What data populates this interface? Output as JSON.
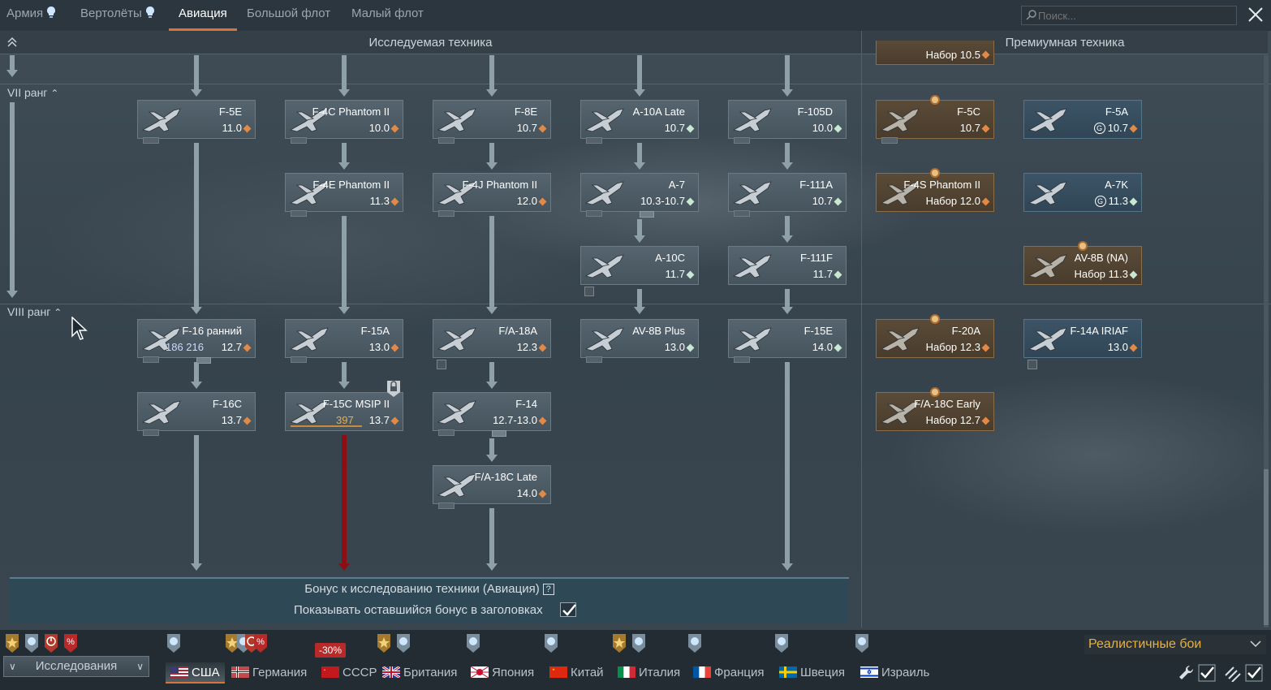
{
  "top_tabs": [
    {
      "label": "Армия",
      "bulb": true
    },
    {
      "label": "Вертолёты",
      "bulb": true
    },
    {
      "label": "Авиация",
      "active": true
    },
    {
      "label": "Большой флот"
    },
    {
      "label": "Малый флот"
    }
  ],
  "search": {
    "placeholder": "Поиск..."
  },
  "sections": {
    "researchable": "Исследуемая техника",
    "premium": "Премиумная техника"
  },
  "ranks": {
    "vii": "VII ранг",
    "viii": "VIII ранг"
  },
  "top_partial_card": {
    "br_text": "Набор 10.5"
  },
  "cards": [
    {
      "name": "F-5E",
      "br": "11.0",
      "type": "r"
    },
    {
      "name": "F-4C Phantom II",
      "br": "10.0",
      "type": "r"
    },
    {
      "name": "F-8E",
      "br": "10.7",
      "type": "r"
    },
    {
      "name": "A-10A Late",
      "br": "10.7",
      "type": "g"
    },
    {
      "name": "F-105D",
      "br": "10.0",
      "type": "g"
    },
    {
      "name": "F-5C",
      "br": "10.7",
      "type": "r"
    },
    {
      "name": "F-5A",
      "br": "10.7",
      "type": "r"
    },
    {
      "name": "F-4E Phantom II",
      "br": "11.3",
      "type": "r"
    },
    {
      "name": "F-4J Phantom II",
      "br": "12.0",
      "type": "r"
    },
    {
      "name": "A-7",
      "br": "10.3-10.7",
      "type": "g"
    },
    {
      "name": "F-111A",
      "br": "10.7",
      "type": "g"
    },
    {
      "name": "F-4S Phantom II",
      "br": "Набор 12.0",
      "type": "r"
    },
    {
      "name": "A-7K",
      "br": "11.3",
      "type": "g"
    },
    {
      "name": "A-10C",
      "br": "11.7",
      "type": "g"
    },
    {
      "name": "F-111F",
      "br": "11.7",
      "type": "g"
    },
    {
      "name": "AV-8B (NA)",
      "br": "Набор 11.3",
      "type": "g"
    },
    {
      "name": "F-16 ранний",
      "br": "12.7",
      "type": "r",
      "rp": "186 216"
    },
    {
      "name": "F-15A",
      "br": "13.0",
      "type": "r"
    },
    {
      "name": "F/A-18A",
      "br": "12.3",
      "type": "r"
    },
    {
      "name": "AV-8B Plus",
      "br": "13.0",
      "type": "g"
    },
    {
      "name": "F-15E",
      "br": "14.0",
      "type": "g"
    },
    {
      "name": "F-20A",
      "br": "Набор 12.3",
      "type": "r"
    },
    {
      "name": "F-14A IRIAF",
      "br": "13.0",
      "type": "r"
    },
    {
      "name": "F-16C",
      "br": "13.7",
      "type": "r"
    },
    {
      "name": "F-15C MSIP II",
      "br": "13.7",
      "type": "r",
      "rp": "397"
    },
    {
      "name": "F-14",
      "br": "12.7-13.0",
      "type": "r"
    },
    {
      "name": "F/A-18C Early",
      "br": "Набор 12.7",
      "type": "r"
    },
    {
      "name": "F/A-18C Late",
      "br": "14.0",
      "type": "r"
    }
  ],
  "bonus": {
    "title": "Бонус к исследованию техники (Авиация)",
    "help": "?",
    "show_label": "Показывать оставшийся бонус в заголовках",
    "checked": true
  },
  "bottom": {
    "research_label": "Исследования",
    "discount": "-30%",
    "nations": [
      {
        "label": "США",
        "active": true
      },
      {
        "label": "Германия"
      },
      {
        "label": "СССР"
      },
      {
        "label": "Британия"
      },
      {
        "label": "Япония"
      },
      {
        "label": "Китай"
      },
      {
        "label": "Италия"
      },
      {
        "label": "Франция"
      },
      {
        "label": "Швеция"
      },
      {
        "label": "Израиль"
      }
    ],
    "game_mode": "Реалистичные бои"
  },
  "colors": {
    "accent": "#d9733a",
    "premium": "#8a6e48",
    "mode": "#e8b13c",
    "rp": "#cfd8ff",
    "rp_gold": "#e6b04a",
    "research_bar": "#8b0f14"
  }
}
